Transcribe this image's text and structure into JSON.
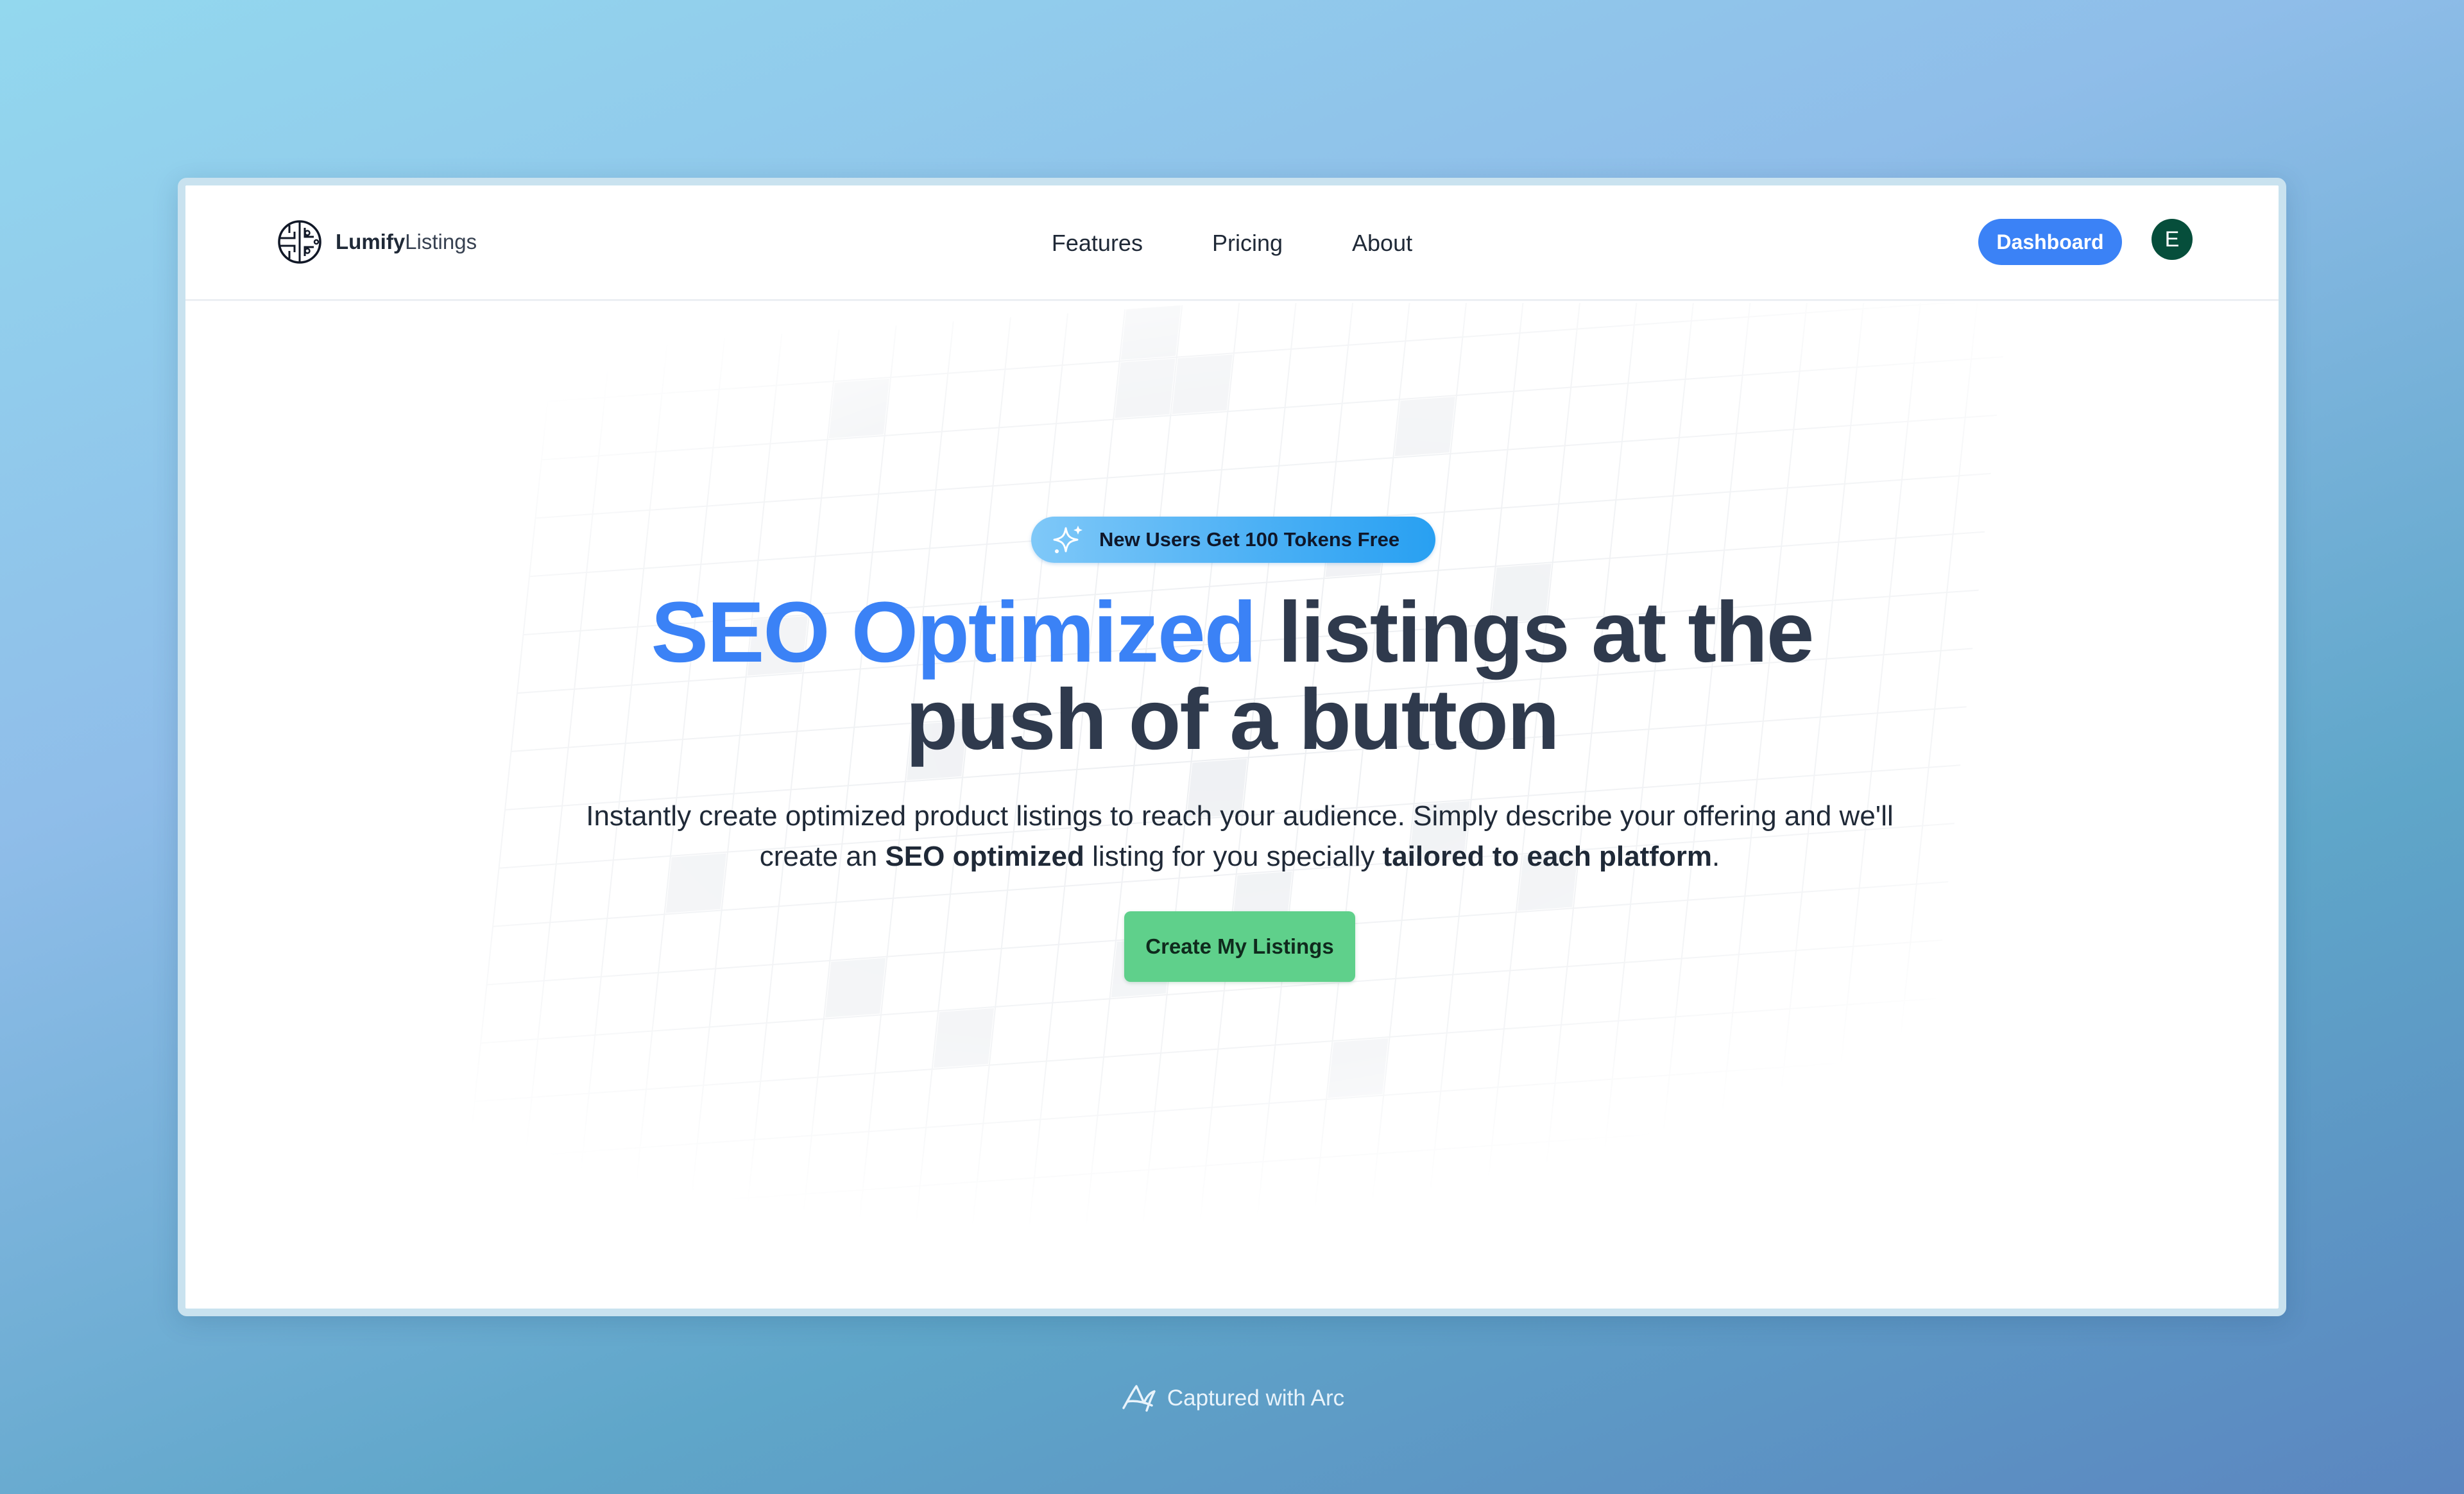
{
  "nav": {
    "logo": {
      "bold": "Lumify",
      "light": "Listings",
      "icon": "circuit-globe-icon"
    },
    "links": [
      "Features",
      "Pricing",
      "About"
    ],
    "dashboard_label": "Dashboard",
    "avatar_initial": "E"
  },
  "hero": {
    "badge": {
      "icon": "sparkle-icon",
      "text": "New Users Get 100 Tokens Free"
    },
    "headline": {
      "accent": "SEO Optimized",
      "line1_rest": " listings at the",
      "line2": "push of a button"
    },
    "subtext": {
      "part1": "Instantly create optimized product listings to reach your audience. Simply describe your offering and we'll create an ",
      "bold1": "SEO optimized",
      "part2": " listing for you specially ",
      "bold2": "tailored to each platform",
      "part3": "."
    },
    "cta_label": "Create My Listings"
  },
  "footer": {
    "captured_text": "Captured with Arc",
    "icon": "arc-logo-icon"
  },
  "colors": {
    "accent": "#3b82f6",
    "headline": "#2f3a4d",
    "cta": "#5fd08b",
    "avatar": "#064e3b",
    "badge_gradient_end": "#28a0f2"
  }
}
